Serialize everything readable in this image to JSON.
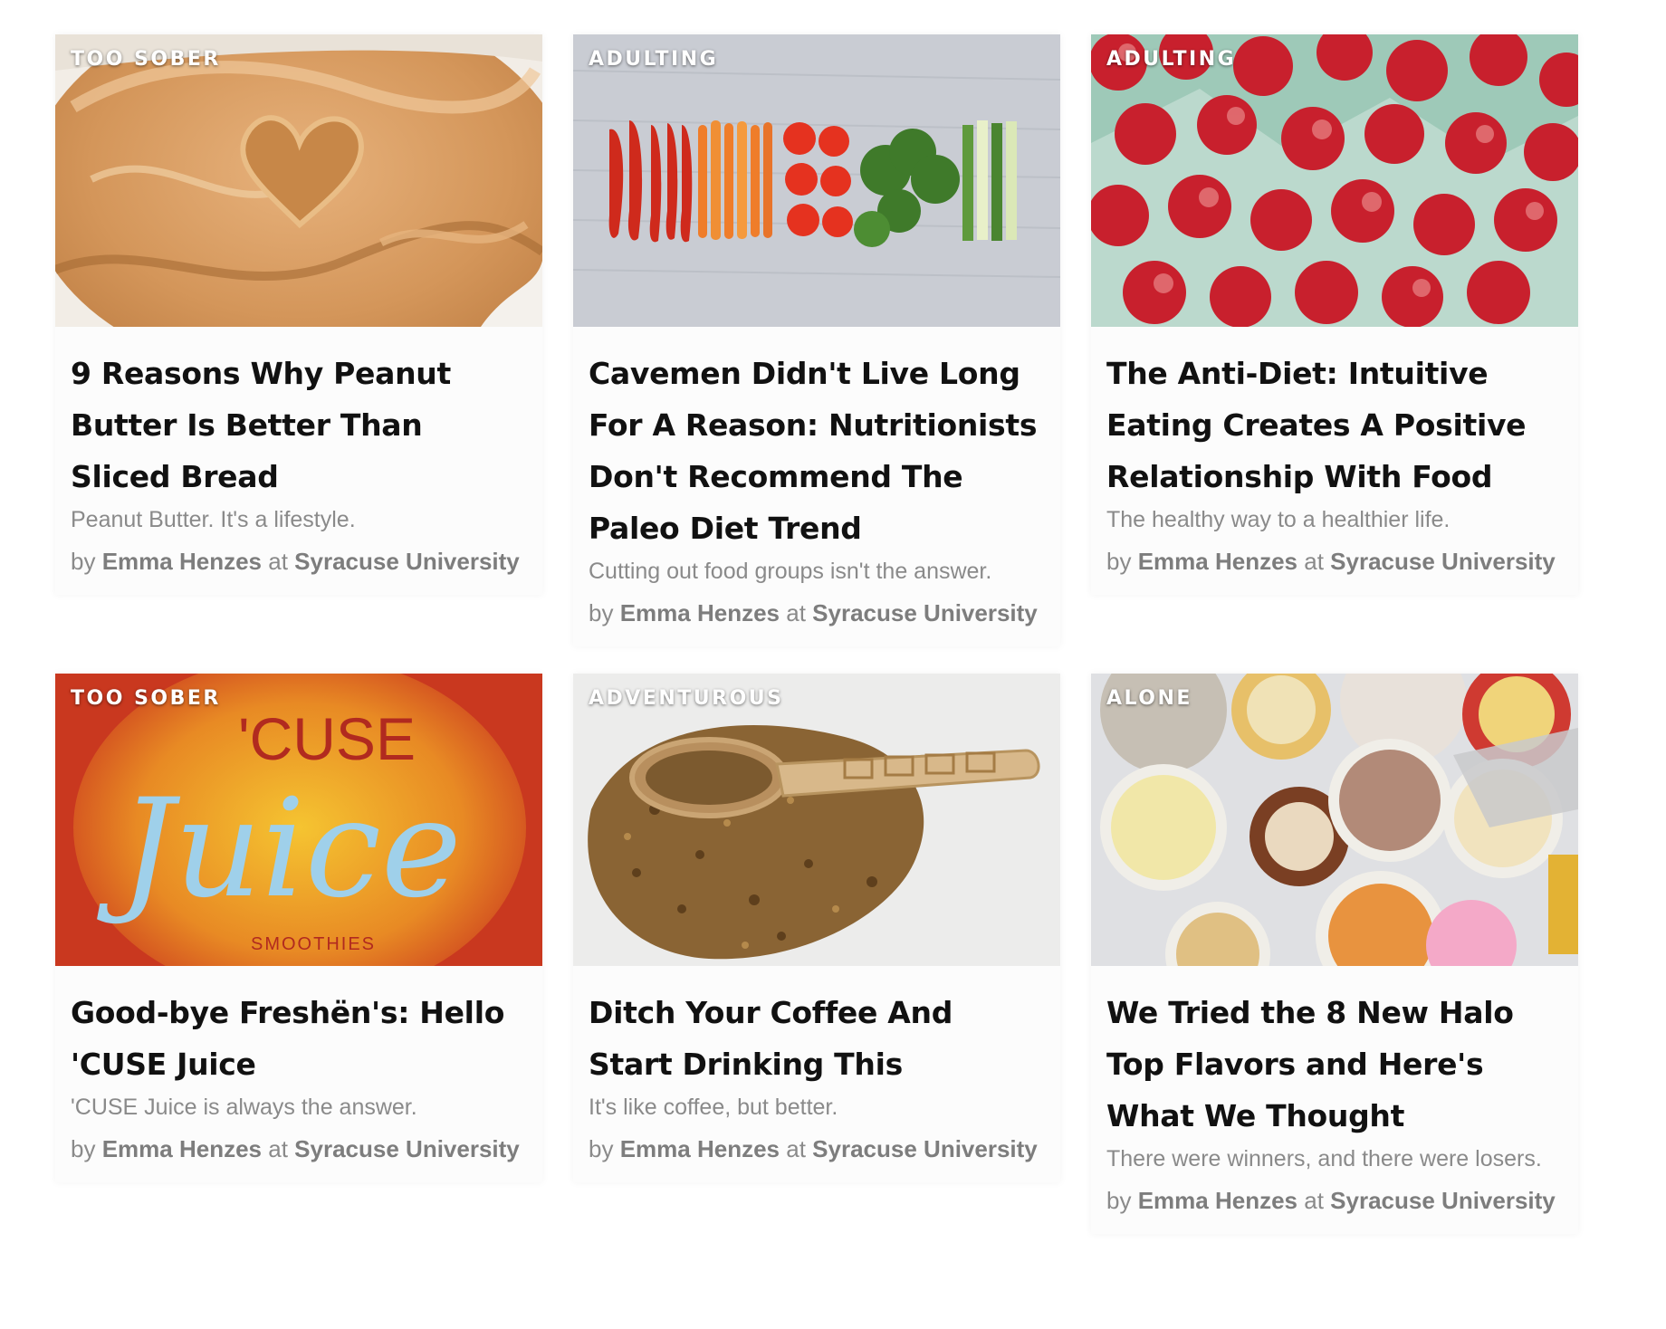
{
  "cards": [
    {
      "tag": "TOO SOBER",
      "title": "9 Reasons Why Peanut Butter Is Better Than Sliced Bread",
      "subtitle": "Peanut Butter. It's a lifestyle.",
      "by": "by",
      "author": "Emma Henzes",
      "at": "at",
      "school": "Syracuse University",
      "image": "peanut-butter-heart-photo"
    },
    {
      "tag": "ADULTING",
      "title": "Cavemen Didn't Live Long For A Reason: Nutritionists Don't Recommend The Paleo Diet Trend",
      "subtitle": "Cutting out food groups isn't the answer.",
      "by": "by",
      "author": "Emma Henzes",
      "at": "at",
      "school": "Syracuse University",
      "image": "vegetables-on-wood-photo"
    },
    {
      "tag": "ADULTING",
      "title": "The Anti-Diet: Intuitive Eating Creates A Positive Relationship With Food",
      "subtitle": "The healthy way to a healthier life.",
      "by": "by",
      "author": "Emma Henzes",
      "at": "at",
      "school": "Syracuse University",
      "image": "red-apples-photo"
    },
    {
      "tag": "TOO SOBER",
      "title": "Good-bye Freshën's: Hello 'CUSE Juice",
      "subtitle": "'CUSE Juice is always the answer.",
      "by": "by",
      "author": "Emma Henzes",
      "at": "at",
      "school": "Syracuse University",
      "image": "cuse-juice-sign-photo",
      "image_text": {
        "top": "'CUSE",
        "script": "Juice",
        "bottom": "SMOOTHIES"
      }
    },
    {
      "tag": "ADVENTUROUS",
      "title": "Ditch Your Coffee And Start Drinking This",
      "subtitle": "It's like coffee, but better.",
      "by": "by",
      "author": "Emma Henzes",
      "at": "at",
      "school": "Syracuse University",
      "image": "yerba-mate-scoop-photo"
    },
    {
      "tag": "ALONE",
      "title": "We Tried the 8 New Halo Top Flavors and Here's What We Thought",
      "subtitle": "There were winners, and there were losers.",
      "by": "by",
      "author": "Emma Henzes",
      "at": "at",
      "school": "Syracuse University",
      "image": "halo-top-pints-photo"
    }
  ],
  "colors": {
    "title": "#111111",
    "meta": "#8a8a8a",
    "card_bg": "#fcfcfc",
    "tag": "#ffffff"
  }
}
